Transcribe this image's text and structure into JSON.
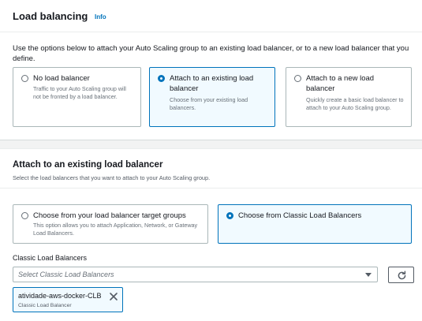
{
  "load_balancing": {
    "title": "Load balancing",
    "info_label": "Info",
    "intro": "Use the options below to attach your Auto Scaling group to an existing load balancer, or to a new load balancer that you define.",
    "options": [
      {
        "title": "No load balancer",
        "description": "Traffic to your Auto Scaling group will not be fronted by a load balancer.",
        "selected": false
      },
      {
        "title": "Attach to an existing load balancer",
        "description": "Choose from your existing load balancers.",
        "selected": true
      },
      {
        "title": "Attach to a new load balancer",
        "description": "Quickly create a basic load balancer to attach to your Auto Scaling group.",
        "selected": false
      }
    ]
  },
  "attach_existing": {
    "title": "Attach to an existing load balancer",
    "description": "Select the load balancers that you want to attach to your Auto Scaling group.",
    "options": [
      {
        "title": "Choose from your load balancer target groups",
        "description": "This option allows you to attach Application, Network, or Gateway Load Balancers.",
        "selected": false
      },
      {
        "title": "Choose from Classic Load Balancers",
        "description": "",
        "selected": true
      }
    ],
    "field_label": "Classic Load Balancers",
    "select_placeholder": "Select Classic Load Balancers",
    "selected_token": {
      "label": "atividade-aws-docker-CLB",
      "sublabel": "Classic Load Balancer"
    }
  },
  "icons": {
    "refresh": "refresh-icon",
    "caret": "caret-down-icon",
    "remove": "close-icon"
  },
  "colors": {
    "accent": "#0073bb",
    "selected_bg": "#f1faff",
    "border": "#aab7b8",
    "page_bg": "#f2f3f3"
  }
}
